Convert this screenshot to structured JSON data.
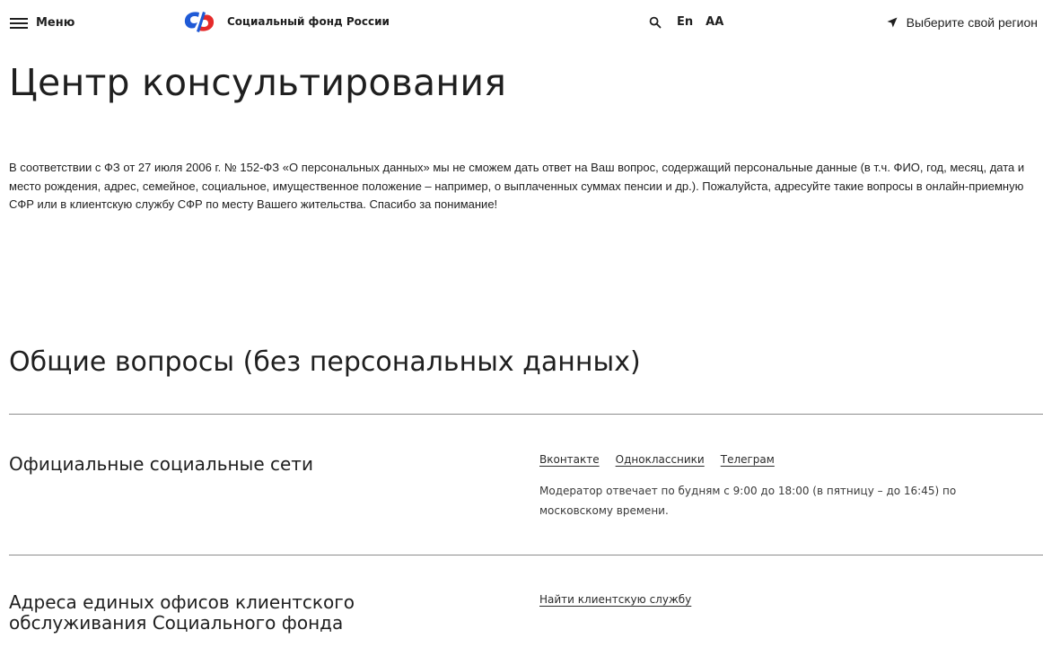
{
  "header": {
    "menu_label": "Меню",
    "brand_name": "Социальный фонд России",
    "lang_label": "En",
    "vision_label": "АА",
    "region_label": "Выберите свой регион",
    "icons": {
      "menu": "hamburger-icon",
      "logo": "sfr-logo-icon",
      "search": "search-icon",
      "region": "location-arrow-icon"
    },
    "colors": {
      "logo_blue": "#1f5ad6",
      "logo_red": "#e52a2a"
    }
  },
  "main": {
    "title": "Центр консультирования",
    "notice": "В соответствии с ФЗ от 27 июля 2006 г. № 152-ФЗ «О персональных данных» мы не сможем дать ответ на Ваш вопрос, содержащий персональные данные (в т.ч. ФИО, год, месяц, дата и место рождения, адрес, семейное, социальное, имущественное положение – например, о выплаченных суммах пенсии и др.). Пожалуйста, адресуйте такие вопросы в онлайн-приемную СФР или в клиентскую службу СФР по месту Вашего жительства. Спасибо за понимание!",
    "section_title": "Общие вопросы (без персональных данных)",
    "rows": [
      {
        "title": "Официальные социальные сети",
        "links": [
          "Вконтакте",
          "Одноклассники",
          "Телеграм"
        ],
        "text": "Модератор отвечает по будням с 9:00 до 18:00 (в пятницу – до 16:45) по московскому времени."
      },
      {
        "title": "Адреса единых офисов клиентского обслуживания Социального фонда",
        "links": [
          "Найти клиентскую службу"
        ]
      }
    ]
  }
}
